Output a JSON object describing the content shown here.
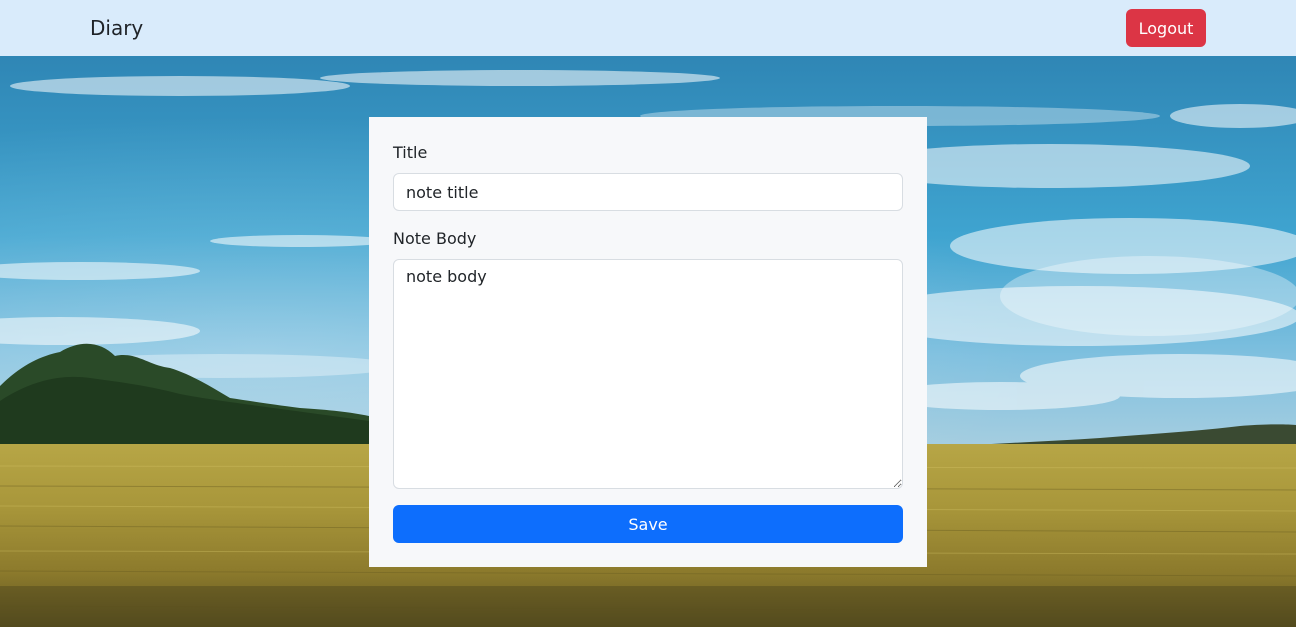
{
  "navbar": {
    "brand": "Diary",
    "logout_label": "Logout",
    "logout_color": "#dc3545",
    "background_color": "#d9ebfb"
  },
  "background": {
    "description_icon": "sky-and-wheat-field-photo"
  },
  "form": {
    "title_label": "Title",
    "title_placeholder": "note title",
    "title_value": "",
    "body_label": "Note Body",
    "body_placeholder": "note body",
    "body_value": "",
    "save_label": "Save",
    "save_color": "#0d6efd"
  }
}
